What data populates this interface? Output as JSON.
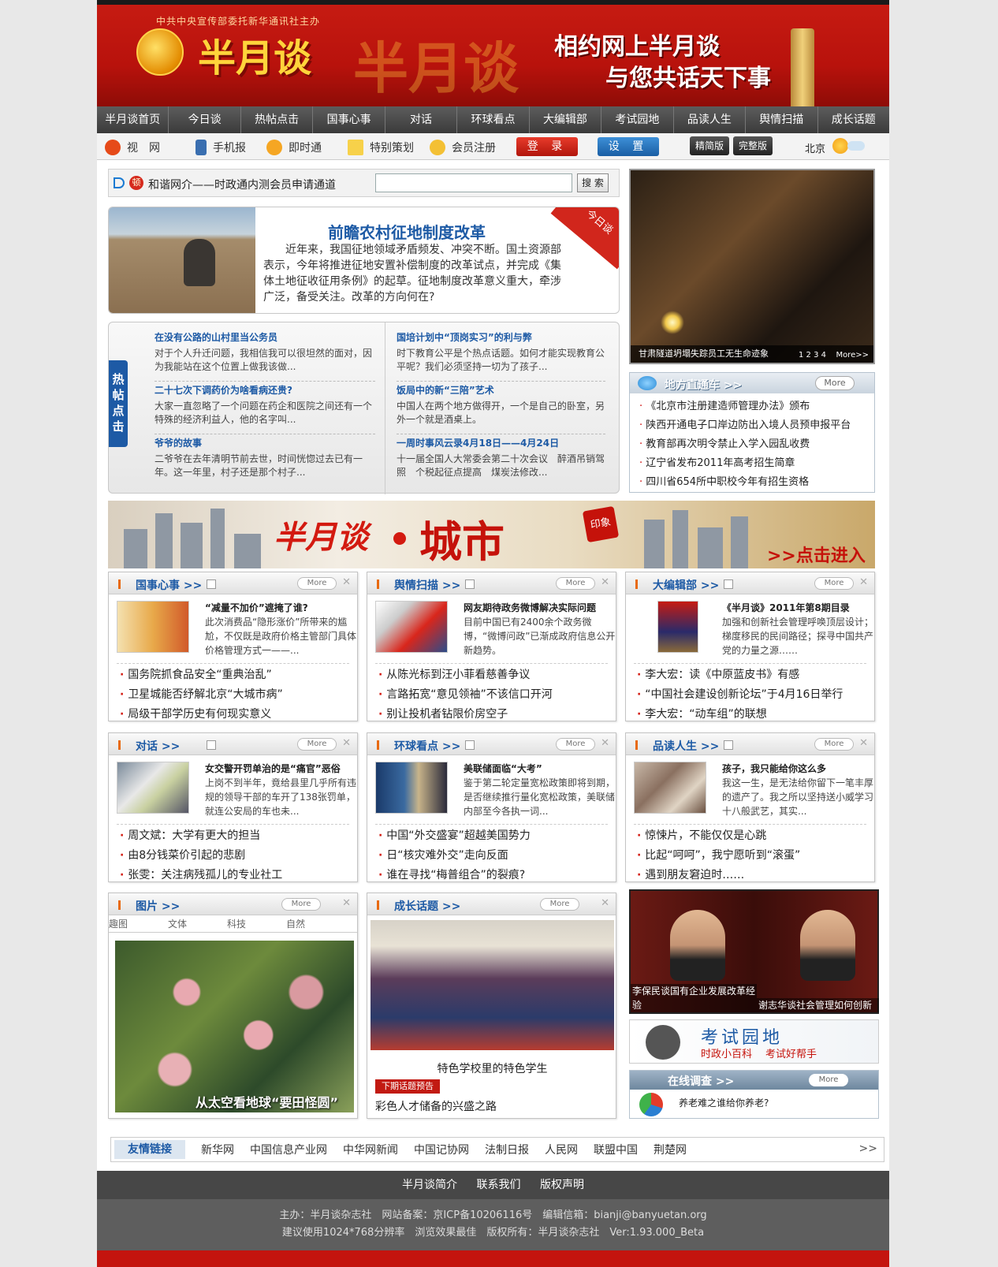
{
  "header": {
    "org": "中共中央宣传部委托新华通讯社主办",
    "logo_text": "半月谈",
    "ghost_text": "半月谈",
    "slogan_line1": "相约网上半月谈",
    "slogan_line2": "与您共话天下事",
    "brand_color": "#c61b12"
  },
  "nav": [
    "半月谈首页",
    "今日谈",
    "热帖点击",
    "国事心事",
    "对话",
    "环球看点",
    "大编辑部",
    "考试园地",
    "品读人生",
    "舆情扫描",
    "成长话题"
  ],
  "subnav": {
    "items": [
      "视　网",
      "手机报",
      "即时通",
      "特别策划",
      "会员注册"
    ],
    "login": "登 录",
    "settings": "设 置",
    "simple": "精简版",
    "full": "完整版",
    "city": "北京"
  },
  "notice": {
    "badge": "顿",
    "text": "和谐网介——时政通内测会员申请通道",
    "search_button": "搜 索",
    "search_value": ""
  },
  "feature": {
    "title": "前瞻农村征地制度改革",
    "body": "近年来，我国征地领域矛盾频发、冲突不断。国土资源部表示，今年将推进征地安置补偿制度的改革试点，并完成《集体土地征收征用条例》的起草。征地制度改革意义重大，牵涉广泛，备受关注。改革的方向何在?",
    "corner": "今日谈"
  },
  "hot": {
    "tag": "热帖点击",
    "left": [
      {
        "title": "在没有公路的山村里当公务员",
        "desc": "对于个人升迁问题，我相信我可以很坦然的面对，因为我能站在这个位置上做我该做..."
      },
      {
        "title": "二十七次下调药价为啥看病还贵?",
        "desc": "大家一直忽略了一个问题在药企和医院之间还有一个特殊的经济利益人，他的名字叫..."
      },
      {
        "title": "爷爷的故事",
        "desc": "二爷爷在去年清明节前去世，时间恍惚过去已有一年。这一年里，村子还是那个村子..."
      }
    ],
    "right": [
      {
        "title": "国培计划中“顶岗实习”的利与弊",
        "desc": "时下教育公平是个热点话题。如何才能实现教育公平呢？我们必须坚持一切为了孩子..."
      },
      {
        "title": "饭局中的新“三陪”艺术",
        "desc": "中国人在两个地方做得开，一个是自己的卧室，另外一个就是酒桌上。"
      },
      {
        "title": "一周时事风云录4月18日——4月24日",
        "desc": "十一届全国人大常委会第二十次会议　醉酒吊销驾照　个税起征点提高　煤炭法修改..."
      }
    ]
  },
  "photo": {
    "caption": "甘肃隧道坍塌失踪员工无生命迹象",
    "pages": "1 2 3 4",
    "more": "More>>"
  },
  "local": {
    "title": "地方直通车 >>",
    "more": "More",
    "items": [
      "《北京市注册建造师管理办法》颁布",
      "陕西开通电子口岸边防出入境人员预申报平台",
      "教育部再次明令禁止入学入园乱收费",
      "辽宁省发布2011年高考招生简章",
      "四川省654所中职校今年有招生资格"
    ]
  },
  "city": {
    "brand": "半月谈",
    "title": "城市",
    "stamp": "印象",
    "enter": ">>点击进入"
  },
  "boxes": [
    {
      "title": "国事心事 >>",
      "more": "More",
      "top_title": "“减量不加价”遮掩了谁?",
      "top_desc": "此次消费品“隐形涨价”所带来的尴尬，不仅既是政府价格主管部门具体价格管理方式一——...",
      "items": [
        "国务院抓食品安全“重典治乱”",
        "卫星城能否纾解北京“大城市病”",
        "局级干部学历史有何现实意义"
      ]
    },
    {
      "title": "舆情扫描 >>",
      "more": "More",
      "top_title": "网友期待政务微博解决实际问题",
      "top_desc": "目前中国已有2400余个政务微博，“微博问政”已渐成政府信息公开新趋势。",
      "items": [
        "从陈光标到汪小菲看慈善争议",
        "言路拓宽“意见领袖”不该信口开河",
        "别让投机者钻限价房空子"
      ]
    },
    {
      "title": "大编辑部 >>",
      "more": "More",
      "top_title": "《半月谈》2011年第8期目录",
      "top_desc": "加强和创新社会管理呼唤顶层设计；梯度移民的民间路径；探寻中国共产党的力量之源……",
      "items": [
        "李大宏：读《中原蓝皮书》有感",
        "“中国社会建设创新论坛”于4月16日举行",
        "李大宏：“动车组”的联想"
      ]
    },
    {
      "title": "对话 >>",
      "more": "More",
      "top_title": "女交警开罚单治的是“痛官”恶俗",
      "top_desc": "上岗不到半年，竟给县里几乎所有违规的领导干部的车开了138张罚单，就连公安局的车也未...",
      "items": [
        "周文斌：大学有更大的担当",
        "由8分钱菜价引起的悲剧",
        "张雯：关注病残孤儿的专业社工"
      ]
    },
    {
      "title": "环球看点 >>",
      "more": "More",
      "top_title": "美联储面临“大考”",
      "top_desc": "鉴于第二轮定量宽松政策即将到期，是否继续推行量化宽松政策，美联储内部至今各执一词...",
      "items": [
        "中国“外交盛宴”超越美国势力",
        "日“核灾难外交”走向反面",
        "谁在寻找“梅普组合”的裂痕?"
      ]
    },
    {
      "title": "品读人生 >>",
      "more": "More",
      "top_title": "孩子，我只能给你这么多",
      "top_desc": "我这一生，是无法给你留下一笔丰厚的遗产了。我之所以坚持送小威学习十八般武艺，其实...",
      "items": [
        "惊悚片，不能仅仅是心跳",
        "比起“呵呵”，我宁愿听到“滚蛋”",
        "遇到朋友窘迫时……"
      ]
    }
  ],
  "pictures": {
    "title": "图片 >>",
    "more": "More",
    "tabs": [
      "趣图",
      "文体",
      "科技",
      "自然"
    ],
    "caption": "从太空看地球“要田怪圆”"
  },
  "growth": {
    "title": "成长话题 >>",
    "more": "More",
    "caption": "特色学校里的特色学生",
    "next_label": "下期话题预告",
    "next_title": "彩色人才储备的兴盛之路"
  },
  "video": {
    "cap1": "李保民谈国有企业发展改革经验",
    "cap2": "谢志华谈社会管理如何创新"
  },
  "exam": {
    "title": "考试园地",
    "sub1": "时政小百科",
    "sub2": "考试好帮手"
  },
  "survey": {
    "title": "在线调查 >>",
    "more": "More",
    "question": "养老难之谁给你养老?"
  },
  "links": {
    "label": "友情链接",
    "items": [
      "新华网",
      "中国信息产业网",
      "中华网新闻",
      "中国记协网",
      "法制日报",
      "人民网",
      "联盟中国",
      "荆楚网"
    ],
    "arrow": ">>"
  },
  "footer": {
    "links": [
      "半月谈简介",
      "联系我们",
      "版权声明"
    ],
    "line1": "主办：半月谈杂志社　网站备案：京ICP备10206116号　编辑信箱：bianji@banyuetan.org",
    "line2": "建议使用1024*768分辨率　浏览效果最佳　版权所有：半月谈杂志社　Ver:1.93.000_Beta"
  }
}
